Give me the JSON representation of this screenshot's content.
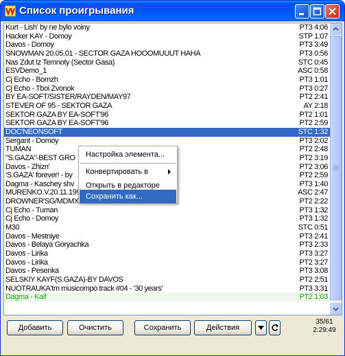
{
  "window": {
    "title": "Список проигрывания"
  },
  "playlist": [
    {
      "name": "Kurt - Lish' by ne bylo voiny",
      "duration": "PT3 4:06",
      "state": "normal"
    },
    {
      "name": "Hacker KAY - Domoy",
      "duration": "STP 1:07",
      "state": "normal"
    },
    {
      "name": "Davos - Domoy",
      "duration": "PT3 3:49",
      "state": "normal"
    },
    {
      "name": "SNOWMAN 20.05.01 - SECTOR GAZA  HOOOMUUUT HAHA",
      "duration": "PT3 0:56",
      "state": "normal"
    },
    {
      "name": "Nas Zdut Iz Temnoty (Sector Gasa)",
      "duration": "STC 0:45",
      "state": "normal"
    },
    {
      "name": "ESVDemo_1",
      "duration": "ASC 0:58",
      "state": "normal"
    },
    {
      "name": "Cj Echo - Bomzh",
      "duration": "PT3 1:01",
      "state": "normal"
    },
    {
      "name": "Cj Echo - Tboi Zvonok",
      "duration": "PT3 0:27",
      "state": "normal"
    },
    {
      "name": "BY EA-SOFT/SISTER/RAYDEN/MAY97",
      "duration": "PT2 2:41",
      "state": "normal"
    },
    {
      "name": "STEVER OF 95 - SEKTOR GAZA",
      "duration": "AY 2:18",
      "state": "normal"
    },
    {
      "name": "SEKTOR GAZA BY EA-SOFT'96",
      "duration": "PT2 1:01",
      "state": "normal"
    },
    {
      "name": "SEKTOR GAZA BY EA-SOFT'96",
      "duration": "PT2 2:59",
      "state": "normal"
    },
    {
      "name": "DOC'NEONSOFT",
      "duration": "STC 1:32",
      "state": "selected"
    },
    {
      "name": "Sergant - Domoy",
      "duration": "PT3 2:02",
      "state": "normal"
    },
    {
      "name": "TUMAN",
      "duration": "PT2 2:48",
      "state": "normal"
    },
    {
      "name": "\"S.GAZA\"-BEST GRO",
      "duration": "PT2 3:19",
      "state": "normal"
    },
    {
      "name": "Davos - Zhizn'",
      "duration": "PT2 3:06",
      "state": "normal"
    },
    {
      "name": "'S.GAZA' forever! - by",
      "duration": "PT2 2:59",
      "state": "normal"
    },
    {
      "name": "Dagma - Kaschey shv",
      "duration": "PT3 1:40",
      "state": "normal"
    },
    {
      "name": "MURENKO.V.20.11.1994 - HIT FROM SECTOR GAZA",
      "duration": "ASC 2:47",
      "state": "normal"
    },
    {
      "name": "DROWNER'SG/MDMX/SBG/ASM'181195",
      "duration": "PT2 2:22",
      "state": "normal"
    },
    {
      "name": "Cj Echo - Tuman",
      "duration": "PT3 1:32",
      "state": "normal"
    },
    {
      "name": "Cj Echo - Domoy",
      "duration": "PT3 1:32",
      "state": "normal"
    },
    {
      "name": "M30",
      "duration": "STC 0:51",
      "state": "normal"
    },
    {
      "name": "Davos - Mestniye",
      "duration": "PT3 2:41",
      "state": "normal"
    },
    {
      "name": "Davos - Belaya Goryachka",
      "duration": "PT3 2:33",
      "state": "normal"
    },
    {
      "name": "Davos - Lirika",
      "duration": "PT3 3:27",
      "state": "normal"
    },
    {
      "name": "Davos - Lirika",
      "duration": "PT2 3:27",
      "state": "normal"
    },
    {
      "name": "Davos - Pesenka",
      "duration": "PT3 3:08",
      "state": "normal"
    },
    {
      "name": "SELSKIY KAYF(S.GAZA)-BY DAVOS",
      "duration": "PT2 2:51",
      "state": "normal"
    },
    {
      "name": "NUOTRAUKA'tm musicompo track #04 - '30 years'",
      "duration": "PT3 3:31",
      "state": "normal"
    },
    {
      "name": "Dagma - Kaif",
      "duration": "PT2 1:03",
      "state": "playing"
    }
  ],
  "context_menu": {
    "items": [
      {
        "label": "Настройка элемента...",
        "has_submenu": false,
        "highlighted": false
      },
      {
        "label": "Конвертировать в",
        "has_submenu": true,
        "highlighted": false
      },
      {
        "label": "Открыть в редакторе",
        "has_submenu": false,
        "highlighted": false
      },
      {
        "label": "Сохранить как...",
        "has_submenu": false,
        "highlighted": true
      }
    ]
  },
  "toolbar": {
    "add_label": "Добавить",
    "clear_label": "Очистить",
    "save_label": "Сохранить",
    "actions_label": "Действия"
  },
  "status": {
    "position": "35/61",
    "total_time": "2:29:49"
  },
  "colors": {
    "selection": "#316ac5",
    "playing_text": "#10b010",
    "titlebar": "#0058ee"
  }
}
